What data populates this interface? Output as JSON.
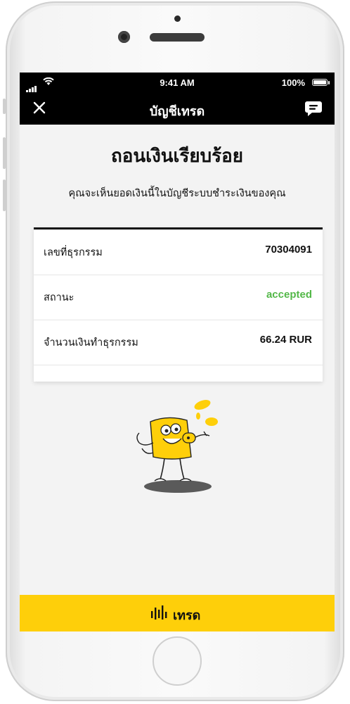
{
  "status_bar": {
    "time": "9:41 AM",
    "battery": "100%"
  },
  "nav": {
    "title": "บัญชีเทรด",
    "close_icon": "close-icon",
    "chat_icon": "chat-bubble-icon"
  },
  "main": {
    "heading": "ถอนเงินเรียบร้อย",
    "subtitle": "คุณจะเห็นยอดเงินนี้ในบัญชีระบบชำระเงินของคุณ"
  },
  "details": [
    {
      "label": "เลขที่ธุรกรรม",
      "value": "70304091"
    },
    {
      "label": "สถานะ",
      "value": "accepted",
      "color": "#53b848"
    },
    {
      "label": "จำนวนเงินทำธุรกรรม",
      "value": "66.24 RUR"
    }
  ],
  "bottom_bar": {
    "label": "เทรด",
    "icon": "candlestick-icon",
    "color": "#fecf0a"
  }
}
